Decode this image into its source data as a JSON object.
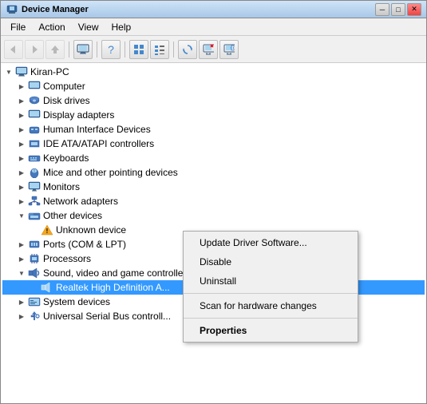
{
  "window": {
    "title": "Device Manager",
    "icon": "💻"
  },
  "title_bar_buttons": {
    "minimize": "─",
    "maximize": "□",
    "close": "✕"
  },
  "menu": {
    "items": [
      {
        "label": "File",
        "id": "file"
      },
      {
        "label": "Action",
        "id": "action"
      },
      {
        "label": "View",
        "id": "view"
      },
      {
        "label": "Help",
        "id": "help"
      }
    ]
  },
  "toolbar": {
    "buttons": [
      {
        "icon": "◀",
        "id": "back",
        "disabled": false
      },
      {
        "icon": "▶",
        "id": "forward",
        "disabled": false
      },
      {
        "icon": "⬆",
        "id": "up",
        "disabled": false
      },
      {
        "icon": "🖥",
        "id": "computer",
        "disabled": false
      },
      {
        "icon": "❓",
        "id": "help",
        "disabled": false
      },
      {
        "icon": "⊞",
        "id": "view1",
        "disabled": false
      },
      {
        "icon": "≡",
        "id": "view2",
        "disabled": false
      },
      {
        "icon": "🔄",
        "id": "refresh",
        "disabled": false
      },
      {
        "icon": "✕",
        "id": "remove",
        "disabled": false
      },
      {
        "icon": "⚙",
        "id": "settings",
        "disabled": false
      }
    ]
  },
  "tree": {
    "root": {
      "label": "Kiran-PC",
      "expanded": true,
      "children": [
        {
          "label": "Computer",
          "type": "computer",
          "expanded": false,
          "indent": 1
        },
        {
          "label": "Disk drives",
          "type": "folder",
          "expanded": false,
          "indent": 1
        },
        {
          "label": "Display adapters",
          "type": "folder",
          "expanded": false,
          "indent": 1
        },
        {
          "label": "Human Interface Devices",
          "type": "folder",
          "expanded": false,
          "indent": 1
        },
        {
          "label": "IDE ATA/ATAPI controllers",
          "type": "folder",
          "expanded": false,
          "indent": 1
        },
        {
          "label": "Keyboards",
          "type": "folder",
          "expanded": false,
          "indent": 1
        },
        {
          "label": "Mice and other pointing devices",
          "type": "folder",
          "expanded": false,
          "indent": 1
        },
        {
          "label": "Monitors",
          "type": "folder",
          "expanded": false,
          "indent": 1
        },
        {
          "label": "Network adapters",
          "type": "folder",
          "expanded": false,
          "indent": 1
        },
        {
          "label": "Other devices",
          "type": "folder",
          "expanded": true,
          "indent": 1
        },
        {
          "label": "Unknown device",
          "type": "warning",
          "expanded": false,
          "indent": 2
        },
        {
          "label": "Ports (COM & LPT)",
          "type": "folder",
          "expanded": false,
          "indent": 1
        },
        {
          "label": "Processors",
          "type": "folder",
          "expanded": false,
          "indent": 1
        },
        {
          "label": "Sound, video and game controllers",
          "type": "folder",
          "expanded": true,
          "indent": 1
        },
        {
          "label": "Realtek High Definition A...",
          "type": "audio",
          "expanded": false,
          "indent": 2,
          "selected": true
        },
        {
          "label": "System devices",
          "type": "folder",
          "expanded": false,
          "indent": 1
        },
        {
          "label": "Universal Serial Bus controll...",
          "type": "folder",
          "expanded": false,
          "indent": 1
        }
      ]
    }
  },
  "context_menu": {
    "items": [
      {
        "label": "Update Driver Software...",
        "id": "update",
        "bold": false,
        "separator_after": false
      },
      {
        "label": "Disable",
        "id": "disable",
        "bold": false,
        "separator_after": false
      },
      {
        "label": "Uninstall",
        "id": "uninstall",
        "bold": false,
        "separator_after": true
      },
      {
        "label": "Scan for hardware changes",
        "id": "scan",
        "bold": false,
        "separator_after": true
      },
      {
        "label": "Properties",
        "id": "properties",
        "bold": true,
        "separator_after": false
      }
    ]
  }
}
